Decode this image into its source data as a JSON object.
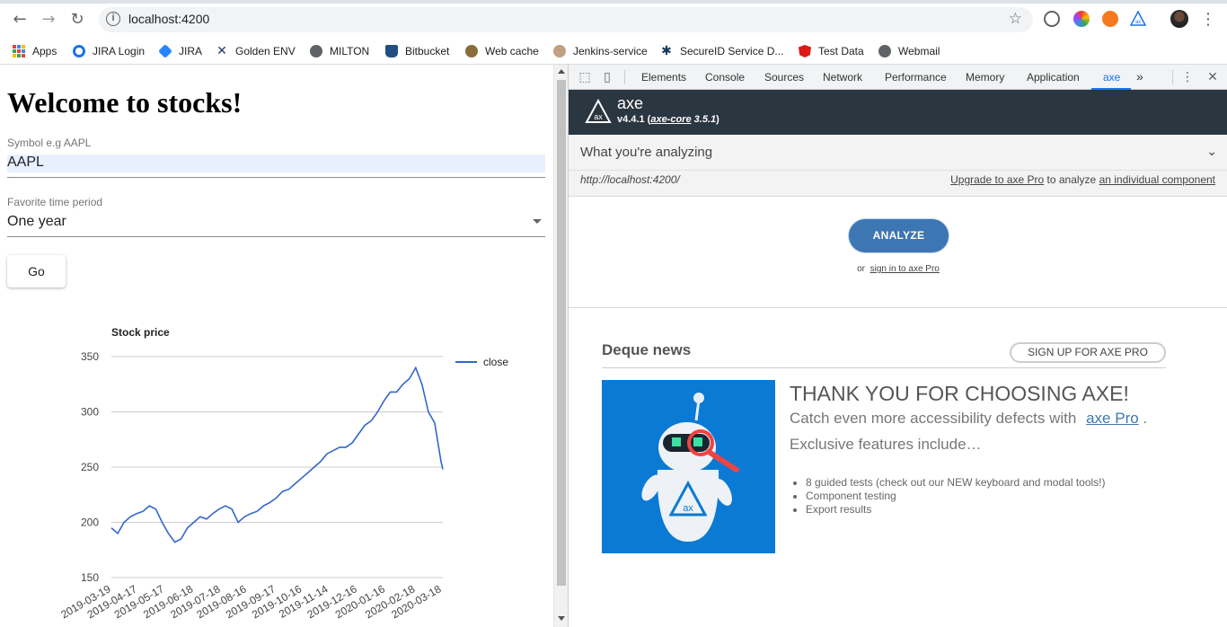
{
  "browser": {
    "url": "localhost:4200",
    "bookmarks": [
      {
        "label": "Apps",
        "color": "#ea4335"
      },
      {
        "label": "JIRA Login",
        "color": "#1a73e8"
      },
      {
        "label": "JIRA",
        "color": "#2684ff"
      },
      {
        "label": "Golden ENV",
        "color": "#1f3b5a"
      },
      {
        "label": "MILTON",
        "color": "#5f6368"
      },
      {
        "label": "Bitbucket",
        "color": "#205081"
      },
      {
        "label": "Web cache",
        "color": "#8a6d3b"
      },
      {
        "label": "Jenkins-service",
        "color": "#c0a080"
      },
      {
        "label": "SecureID Service D...",
        "color": "#1a3a5a"
      },
      {
        "label": "Test Data",
        "color": "#dd1b16"
      },
      {
        "label": "Webmail",
        "color": "#5f6368"
      }
    ]
  },
  "app": {
    "heading": "Welcome to stocks!",
    "symbol_label": "Symbol e.g AAPL",
    "symbol_value": "AAPL",
    "period_label": "Favorite time period",
    "period_value": "One year",
    "go_label": "Go"
  },
  "chart_data": {
    "type": "line",
    "title": "Stock price",
    "xlabel": "",
    "ylabel": "",
    "ylim": [
      150,
      350
    ],
    "yticks": [
      150,
      200,
      250,
      300,
      350
    ],
    "xticks": [
      "2019-03-19",
      "2019-04-17",
      "2019-05-17",
      "2019-06-18",
      "2019-07-18",
      "2019-08-16",
      "2019-09-17",
      "2019-10-16",
      "2019-11-14",
      "2019-12-16",
      "2020-01-16",
      "2020-02-18",
      "2020-03-18"
    ],
    "legend": "right",
    "grid": true,
    "color": "#3366cc",
    "series": [
      {
        "name": "close",
        "x": [
          "2019-03-19",
          "2019-03-26",
          "2019-04-02",
          "2019-04-09",
          "2019-04-16",
          "2019-04-23",
          "2019-04-30",
          "2019-05-07",
          "2019-05-14",
          "2019-05-21",
          "2019-05-28",
          "2019-06-04",
          "2019-06-11",
          "2019-06-18",
          "2019-06-25",
          "2019-07-02",
          "2019-07-09",
          "2019-07-16",
          "2019-07-23",
          "2019-07-30",
          "2019-08-06",
          "2019-08-13",
          "2019-08-20",
          "2019-08-27",
          "2019-09-03",
          "2019-09-10",
          "2019-09-17",
          "2019-09-24",
          "2019-10-01",
          "2019-10-08",
          "2019-10-15",
          "2019-10-22",
          "2019-10-29",
          "2019-11-05",
          "2019-11-12",
          "2019-11-19",
          "2019-11-26",
          "2019-12-03",
          "2019-12-10",
          "2019-12-17",
          "2019-12-24",
          "2019-12-31",
          "2020-01-07",
          "2020-01-14",
          "2020-01-21",
          "2020-01-28",
          "2020-02-04",
          "2020-02-11",
          "2020-02-18",
          "2020-02-25",
          "2020-03-03",
          "2020-03-10",
          "2020-03-17",
          "2020-03-19"
        ],
        "values": [
          195,
          190,
          200,
          205,
          208,
          210,
          215,
          212,
          200,
          190,
          182,
          185,
          195,
          200,
          205,
          203,
          208,
          212,
          215,
          212,
          200,
          205,
          208,
          210,
          215,
          218,
          222,
          228,
          230,
          235,
          240,
          245,
          250,
          255,
          262,
          265,
          268,
          268,
          272,
          280,
          288,
          292,
          300,
          310,
          318,
          318,
          325,
          330,
          340,
          325,
          300,
          290,
          255,
          248
        ]
      }
    ]
  },
  "devtools": {
    "tabs": [
      "Elements",
      "Console",
      "Sources",
      "Network",
      "Performance",
      "Memory",
      "Application",
      "axe"
    ],
    "more": "»",
    "axe": {
      "name": "axe",
      "version": "v4.4.1",
      "core_label": "axe-core",
      "core_version": "3.5.1",
      "analyzing_title": "What you're analyzing",
      "analyzing_url": "http://localhost:4200/",
      "upgrade_link": "Upgrade to axe Pro",
      "upgrade_middle": "to analyze",
      "upgrade_tail": "an individual component",
      "analyze_button": "ANALYZE",
      "signin_or": "or",
      "signin_link": "sign in to axe Pro",
      "news_title": "Deque news",
      "signup_button": "SIGN UP FOR AXE PRO",
      "thank_you": "THANK YOU FOR CHOOSING AXE!",
      "catch_text": "Catch even more accessibility defects with",
      "catch_link": "axe Pro",
      "catch_end": ".",
      "exclusive": "Exclusive features include…",
      "features": [
        "8 guided tests (check out our NEW keyboard and modal tools!)",
        "Component testing",
        "Export results"
      ]
    }
  }
}
